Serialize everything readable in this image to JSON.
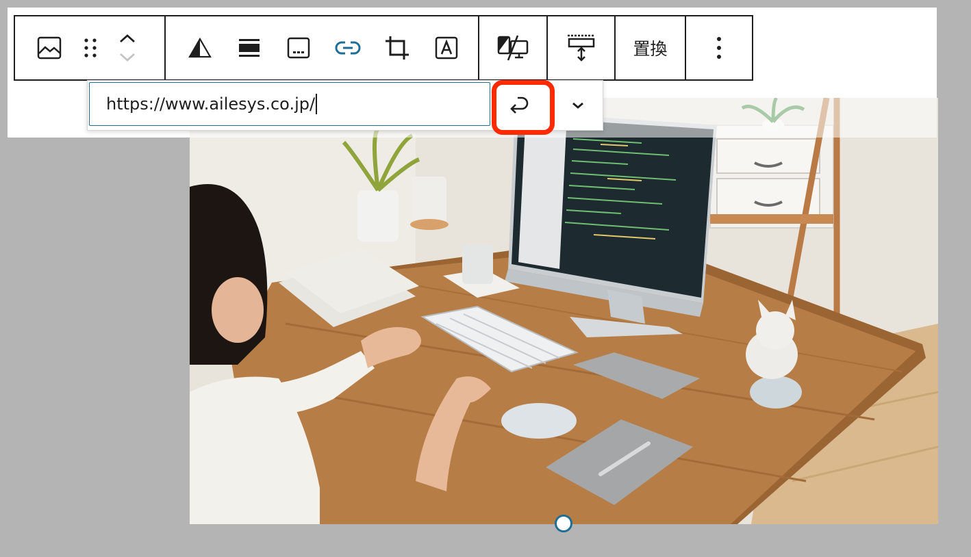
{
  "toolbar": {
    "groups": [
      {
        "items": [
          "image-icon",
          "drag-handle-icon",
          "move-up-icon",
          "move-down-icon"
        ]
      },
      {
        "items": [
          "duotone-icon",
          "align-icon",
          "caption-icon",
          "link-icon",
          "crop-icon",
          "text-overlay-icon"
        ]
      },
      {
        "items": [
          "unsync-icon"
        ]
      },
      {
        "items": [
          "height-icon"
        ]
      },
      {
        "items": [
          "replace"
        ]
      },
      {
        "items": [
          "options-icon"
        ]
      }
    ],
    "replace_label": "置換",
    "accent_color": "#1e6e95"
  },
  "link_popover": {
    "url_value": "https://www.ailesys.co.jp/",
    "submit_icon": "enter-return-icon",
    "expand_icon": "chevron-down-icon"
  },
  "highlight": {
    "color": "#ff2a00",
    "target": "submit-button"
  },
  "image_block": {
    "handle_color": "#1e6e95"
  }
}
